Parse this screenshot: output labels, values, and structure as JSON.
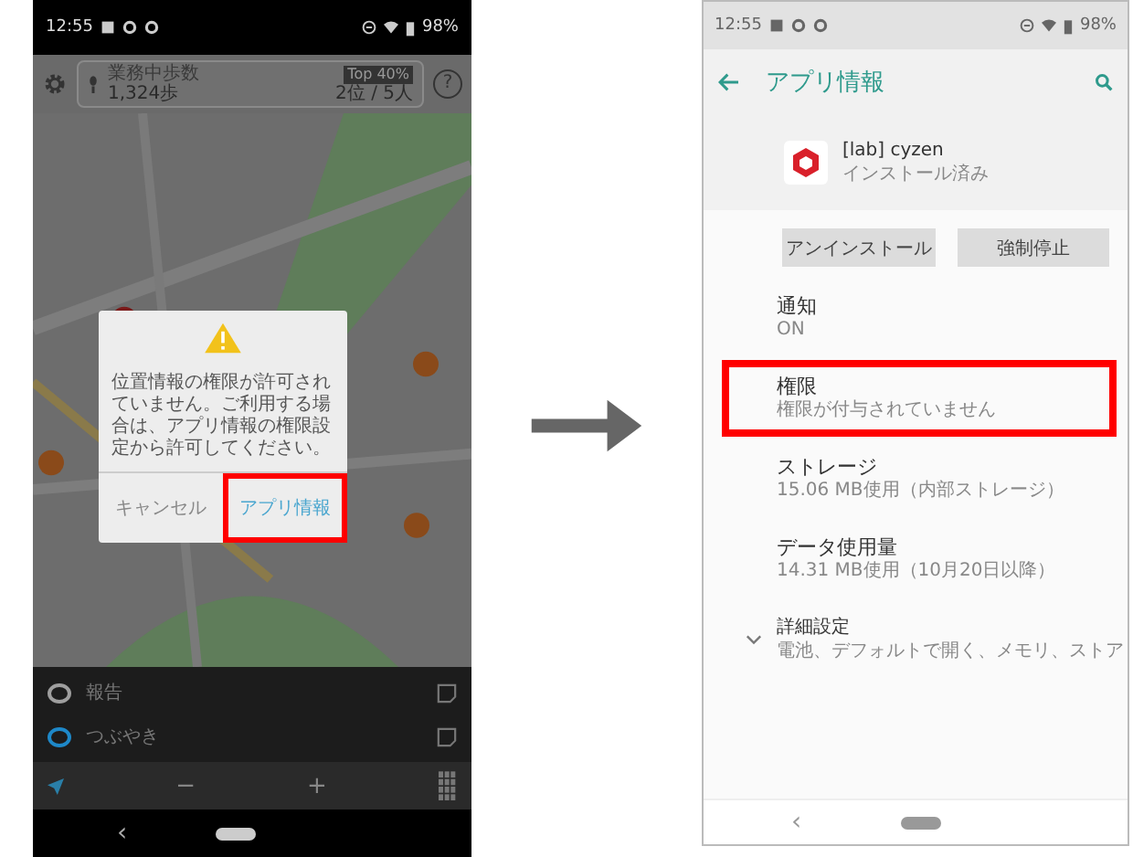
{
  "left_screen": {
    "status_bar": {
      "time": "12:55",
      "battery": "98%"
    },
    "step_card": {
      "label": "業務中歩数",
      "steps": "1,324歩",
      "badge": "Top 40%",
      "rank": "2位 / 5人"
    },
    "help": "?",
    "dialog": {
      "message": "位置情報の権限が許可されていません。ご利用する場合は、アプリ情報の権限設定から許可してください。",
      "buttons": [
        {
          "label": "キャンセル",
          "highlighted": false
        },
        {
          "label": "アプリ情報",
          "highlighted": true
        }
      ]
    },
    "list": [
      {
        "label": "報告",
        "color": "#9e9e9e"
      },
      {
        "label": "つぶやき",
        "color": "#1e88c8"
      }
    ],
    "toolbar": {
      "zoom_out": "−",
      "zoom_in": "+"
    },
    "nav_back": "‹"
  },
  "right_screen": {
    "status_bar": {
      "time": "12:55",
      "battery": "98%"
    },
    "title": "アプリ情報",
    "app": {
      "name": "[lab] cyzen",
      "status": "インストール済み"
    },
    "buttons": [
      "アンインストール",
      "強制停止"
    ],
    "items": [
      {
        "kind": "setting",
        "title": "通知",
        "subtitle": "ON",
        "highlighted": false
      },
      {
        "kind": "setting",
        "title": "権限",
        "subtitle": "権限が付与されていません",
        "highlighted": true
      },
      {
        "kind": "setting",
        "title": "ストレージ",
        "subtitle": "15.06 MB使用（内部ストレージ）",
        "highlighted": false
      },
      {
        "kind": "setting",
        "title": "データ使用量",
        "subtitle": "14.31 MB使用（10月20日以降）",
        "highlighted": false
      },
      {
        "kind": "group",
        "title": "詳細設定",
        "subtitle": "電池、デフォルトで開く、メモリ、ストア",
        "highlighted": false
      }
    ],
    "nav_back": "‹"
  }
}
